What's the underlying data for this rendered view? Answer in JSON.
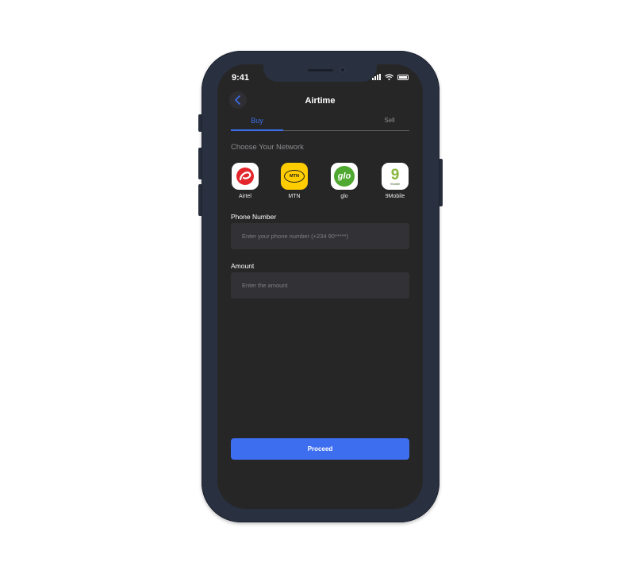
{
  "status_bar": {
    "time": "9:41"
  },
  "header": {
    "title": "Airtime"
  },
  "tabs": {
    "buy": "Buy",
    "sell": "Sell"
  },
  "network_section": {
    "heading": "Choose Your Network",
    "networks": [
      {
        "label": "Airtel",
        "color": "#e3262c"
      },
      {
        "label": "MTN",
        "logo_text": "MTN",
        "color": "#ffcc00"
      },
      {
        "label": "glo",
        "logo_text": "glo",
        "color": "#4fa82f"
      },
      {
        "label": "9Mobile",
        "logo_text": "9",
        "logo_subtext": "9mobile",
        "color": "#87b63d"
      }
    ]
  },
  "phone_field": {
    "label": "Phone Number",
    "placeholder": "Enter your phone number (+234 90*****)"
  },
  "amount_field": {
    "label": "Amount",
    "placeholder": "Enter the amount"
  },
  "proceed_button": {
    "label": "Proceed"
  },
  "colors": {
    "accent": "#3d6ef0",
    "screen_bg": "#262626",
    "device_body": "#29303f"
  }
}
